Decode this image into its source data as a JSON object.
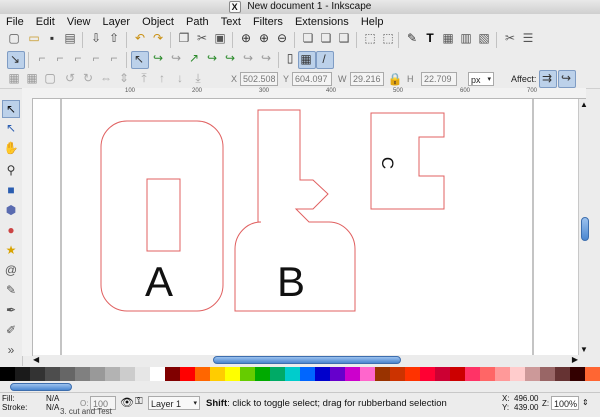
{
  "window": {
    "title": "New document 1 - Inkscape",
    "close_glyph": "X"
  },
  "menu": [
    "File",
    "Edit",
    "View",
    "Layer",
    "Object",
    "Path",
    "Text",
    "Filters",
    "Extensions",
    "Help"
  ],
  "tool_controls": {
    "x_label": "X",
    "x_value": "502.508",
    "y_label": "Y",
    "y_value": "604.097",
    "w_label": "W",
    "w_value": "29.216",
    "h_label": "H",
    "h_value": "22.709",
    "unit": "px",
    "affect_label": "Affect:"
  },
  "ruler_labels": [
    "100",
    "200",
    "300",
    "400",
    "500",
    "600",
    "700"
  ],
  "canvas": {
    "shape_color": "#e06060",
    "labels": {
      "a": "A",
      "b": "B",
      "c": "C"
    }
  },
  "palette_colors": [
    "#000000",
    "#1a1a1a",
    "#333333",
    "#4d4d4d",
    "#666666",
    "#808080",
    "#999999",
    "#b3b3b3",
    "#cccccc",
    "#e6e6e6",
    "#ffffff",
    "#800000",
    "#ff0000",
    "#ff6600",
    "#ffcc00",
    "#ffff00",
    "#66cc00",
    "#00aa00",
    "#00aa66",
    "#00cccc",
    "#0066ff",
    "#0000cc",
    "#6600cc",
    "#cc00cc",
    "#ff66cc",
    "#993300",
    "#cc3300",
    "#ff3300",
    "#ff0033",
    "#cc0033",
    "#cc0000",
    "#ff3366",
    "#ff6666",
    "#ff9999",
    "#ffcccc",
    "#cc9999",
    "#996666",
    "#663333",
    "#330000",
    "#ff6633"
  ],
  "status": {
    "fill_label": "Fill:",
    "fill_value": "N/A",
    "stroke_label": "Stroke:",
    "stroke_value": "N/A",
    "opacity_label": "O:",
    "opacity_value": "100",
    "layer": "Layer 1",
    "message_bold": "Shift",
    "message": ": click to toggle select; drag for rubberband selection",
    "x_label": "X:",
    "x_value": "496.00",
    "y_label": "Y:",
    "y_value": "439.00",
    "zoom_label": "Z:",
    "zoom_value": "100%",
    "below_hint": "3. cut and Test"
  }
}
